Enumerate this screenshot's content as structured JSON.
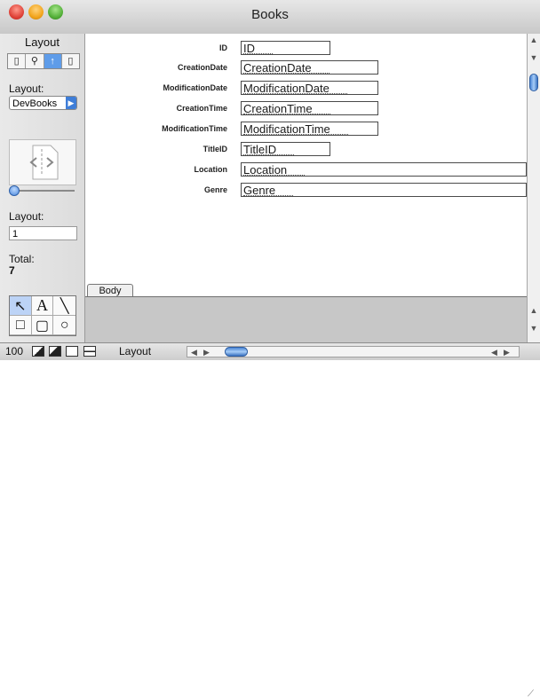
{
  "window": {
    "title": "Books"
  },
  "tools_panel": {
    "heading": "Layout",
    "mode_icons": [
      "browse-icon",
      "find-icon",
      "layout-icon",
      "preview-icon"
    ],
    "layout_label": "Layout:",
    "layout_popup_value": "DevBooks",
    "record_label": "Layout:",
    "record_value": "1",
    "total_label": "Total:",
    "total_value": "7",
    "palette_tools": [
      {
        "name": "pointer-tool-icon",
        "glyph": "↖"
      },
      {
        "name": "text-tool-icon",
        "glyph": "A"
      },
      {
        "name": "line-tool-icon",
        "glyph": "╲"
      },
      {
        "name": "rectangle-tool-icon",
        "glyph": "□"
      },
      {
        "name": "rounded-rect-tool-icon",
        "glyph": "▢"
      },
      {
        "name": "oval-tool-icon",
        "glyph": "○"
      }
    ]
  },
  "fields": [
    {
      "label": "ID",
      "value": "ID",
      "width": "short"
    },
    {
      "label": "CreationDate",
      "value": "CreationDate",
      "width": "medium"
    },
    {
      "label": "ModificationDate",
      "value": "ModificationDate",
      "width": "medium"
    },
    {
      "label": "CreationTime",
      "value": "CreationTime",
      "width": "medium"
    },
    {
      "label": "ModificationTime",
      "value": "ModificationTime",
      "width": "medium"
    },
    {
      "label": "TitleID",
      "value": "TitleID",
      "width": "short"
    },
    {
      "label": "Location",
      "value": "Location",
      "width": "long"
    },
    {
      "label": "Genre",
      "value": "Genre",
      "width": "long"
    }
  ],
  "part_label": "Body",
  "statusbar": {
    "zoom": "100",
    "mode": "Layout"
  },
  "colors": {
    "accent": "#5e9ce9",
    "titlebar": "#d6d6d6",
    "lower_gray": "#c7c7c7"
  }
}
